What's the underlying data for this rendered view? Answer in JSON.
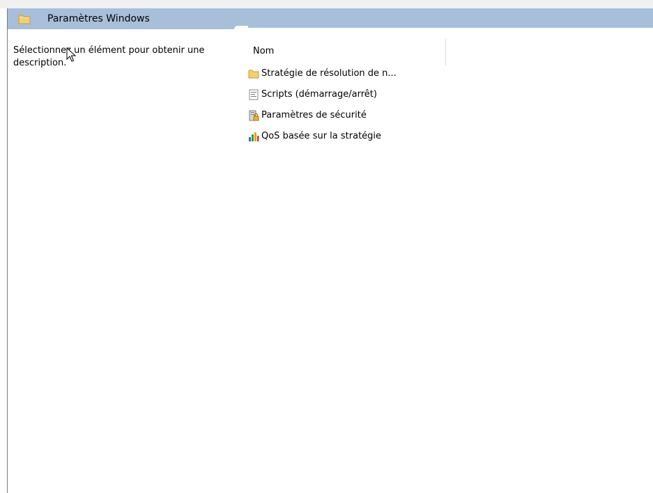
{
  "header": {
    "title": "Paramètres Windows",
    "icon": "folder-icon"
  },
  "description": {
    "text": "Sélectionnez un élément pour obtenir une description."
  },
  "list": {
    "column_name": "Nom",
    "items": [
      {
        "label": "Stratégie de résolution de n...",
        "icon": "folder-icon"
      },
      {
        "label": "Scripts (démarrage/arrêt)",
        "icon": "script-icon"
      },
      {
        "label": "Paramètres de sécurité",
        "icon": "security-settings-icon"
      },
      {
        "label": "QoS basée sur la stratégie",
        "icon": "qos-chart-icon"
      }
    ]
  },
  "colors": {
    "title_bar": "#a8bfda",
    "folder": "#f1cf72"
  }
}
